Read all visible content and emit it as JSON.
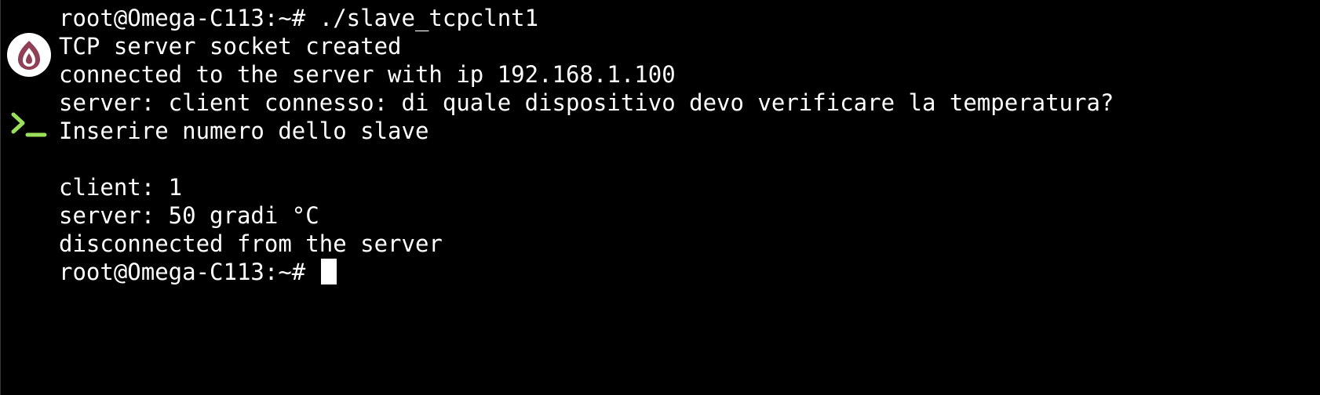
{
  "terminal": {
    "icons": {
      "app": "onion-logo-icon",
      "prompt": "terminal-prompt-icon"
    },
    "colors": {
      "background": "#000000",
      "text": "#ffffff",
      "app_icon_fill": "#8f3f56",
      "prompt_icon": "#9ae05a",
      "cursor": "#ffffff"
    },
    "lines": [
      "root@Omega-C113:~# ./slave_tcpclnt1",
      "TCP server socket created",
      "connected to the server with ip 192.168.1.100",
      "server: client connesso: di quale dispositivo devo verificare la temperatura?",
      "Inserire numero dello slave",
      "",
      "client: 1",
      "server: 50 gradi °C",
      "disconnected from the server"
    ],
    "prompt": "root@Omega-C113:~# "
  }
}
